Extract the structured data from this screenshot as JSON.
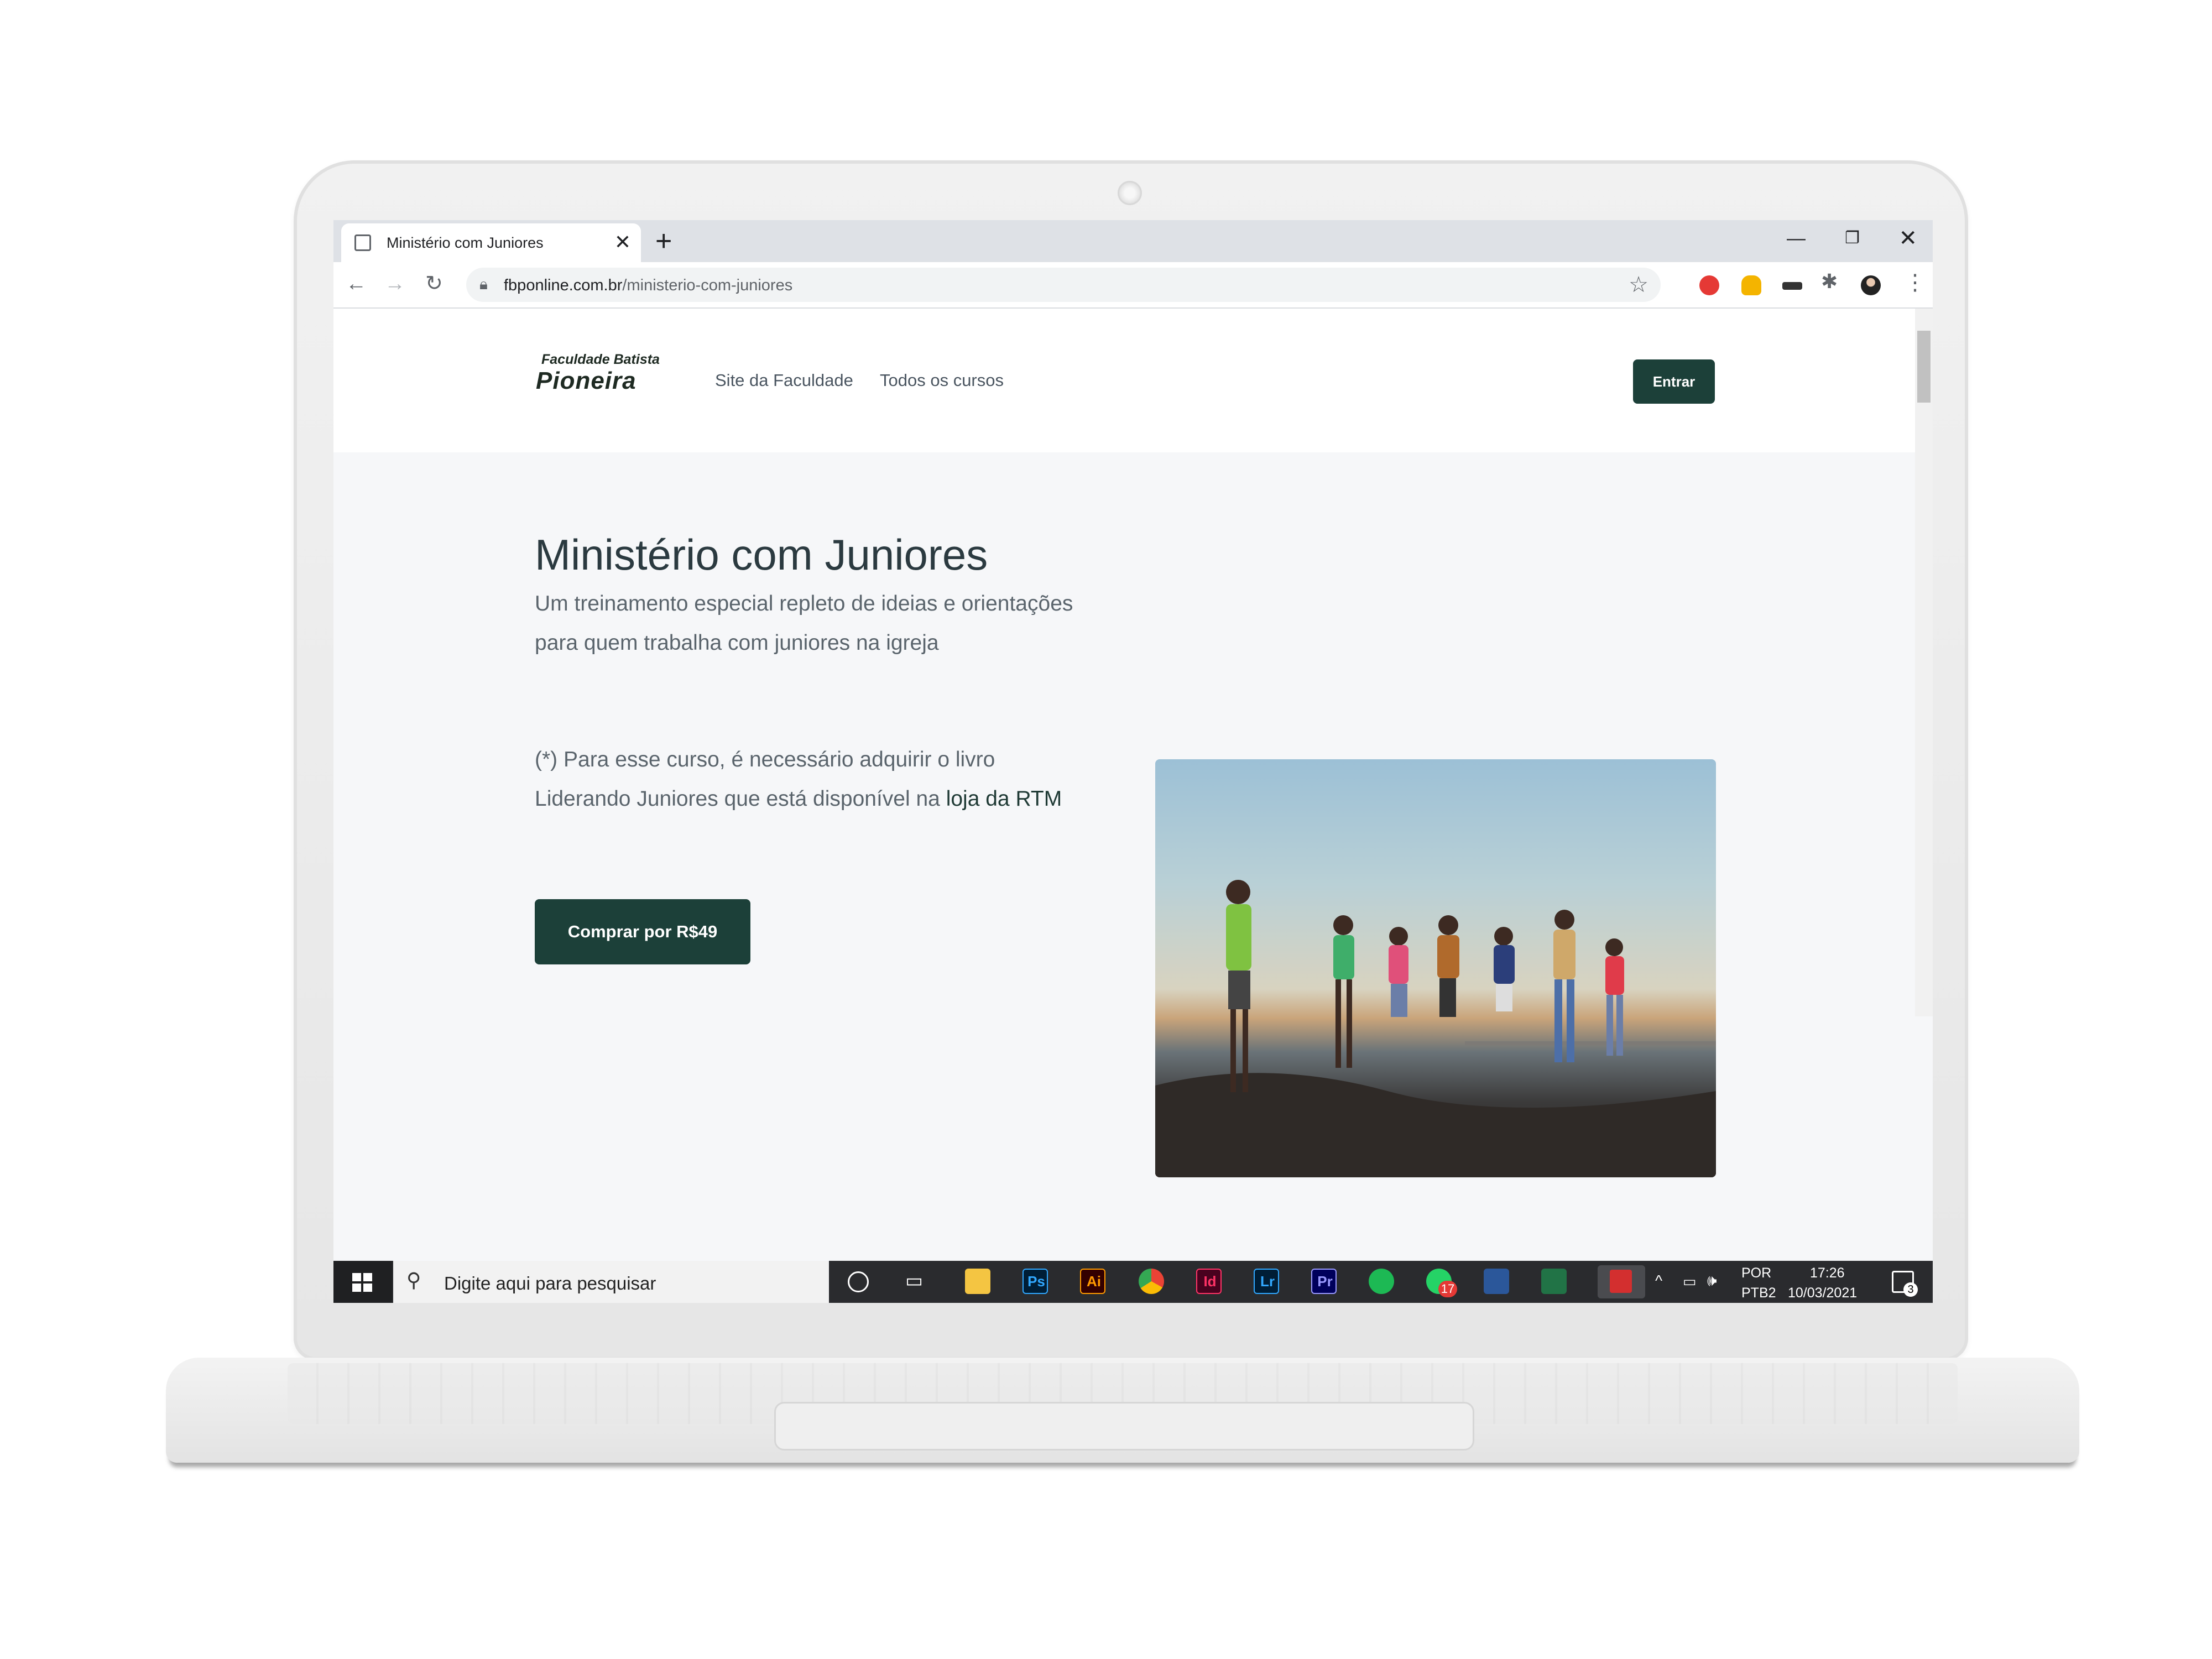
{
  "browser": {
    "tab_title": "Ministério com Juniores",
    "new_tab": "+",
    "url_domain": "fbponline.com.br",
    "url_path": "/ministerio-com-juniores"
  },
  "site": {
    "logo_top": "Faculdade Batista",
    "logo_main": "Pioneira",
    "nav": [
      "Site da Faculdade",
      "Todos os cursos"
    ],
    "login_label": "Entrar"
  },
  "hero": {
    "title": "Ministério com Juniores",
    "subtitle": "Um treinamento especial repleto de ideias e orientações para quem trabalha com juniores na igreja",
    "note_prefix": "(*) Para esse curso, é necessário adquirir o livro Liderando Juniores que está disponível na ",
    "note_link": "loja da RTM",
    "buy_label": "Comprar por R$49"
  },
  "taskbar": {
    "search_placeholder": "Digite aqui para pesquisar",
    "apps": [
      {
        "name": "photoshop",
        "label": "Ps",
        "color": "#31a8ff",
        "bg": "#001e36"
      },
      {
        "name": "illustrator",
        "label": "Ai",
        "color": "#ff9a00",
        "bg": "#330000"
      },
      {
        "name": "indesign",
        "label": "Id",
        "color": "#ff3366",
        "bg": "#49021f"
      },
      {
        "name": "lightroom",
        "label": "Lr",
        "color": "#31a8ff",
        "bg": "#001e36"
      },
      {
        "name": "premiere",
        "label": "Pr",
        "color": "#9999ff",
        "bg": "#00005b"
      }
    ],
    "whatsapp_badge": "17",
    "lang_top": "POR",
    "lang_bottom": "PTB2",
    "time": "17:26",
    "date": "10/03/2021",
    "notification_count": "3"
  }
}
